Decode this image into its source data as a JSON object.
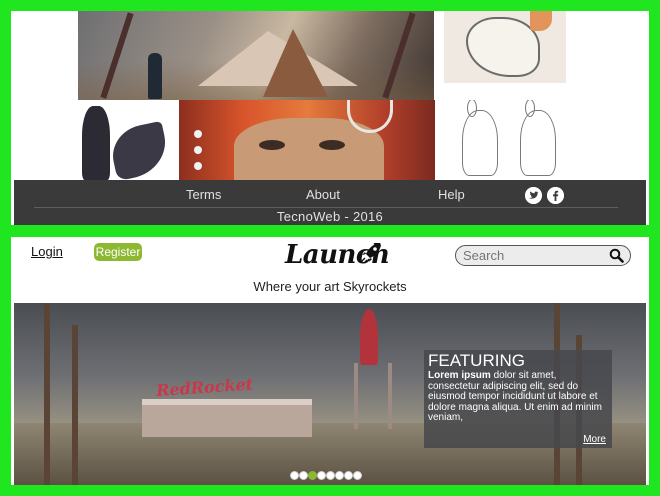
{
  "footer": {
    "links": [
      "Terms",
      "About",
      "Help"
    ],
    "copyright": "TecnoWeb - 2016",
    "social": [
      "twitter-icon",
      "facebook-icon"
    ]
  },
  "header": {
    "login_label": "Login",
    "register_label": "Register",
    "logo_text": "Launch",
    "tagline": "Where your art Skyrockets",
    "search_placeholder": "Search"
  },
  "hero": {
    "sign_text": "RedRocket",
    "featuring_title": "FEATURING",
    "featuring_lead": "Lorem ipsum",
    "featuring_text": "dolor sit amet, consectetur adipiscing elit, sed do eiusmod tempor incididunt ut labore et dolore magna aliqua. Ut enim ad minim veniam,",
    "more_label": "More",
    "dots": 8,
    "active_dot": 3
  },
  "colors": {
    "accent_green": "#8cb832",
    "frame_green": "#1fe61f",
    "footer_bg": "#3a3a3a"
  }
}
